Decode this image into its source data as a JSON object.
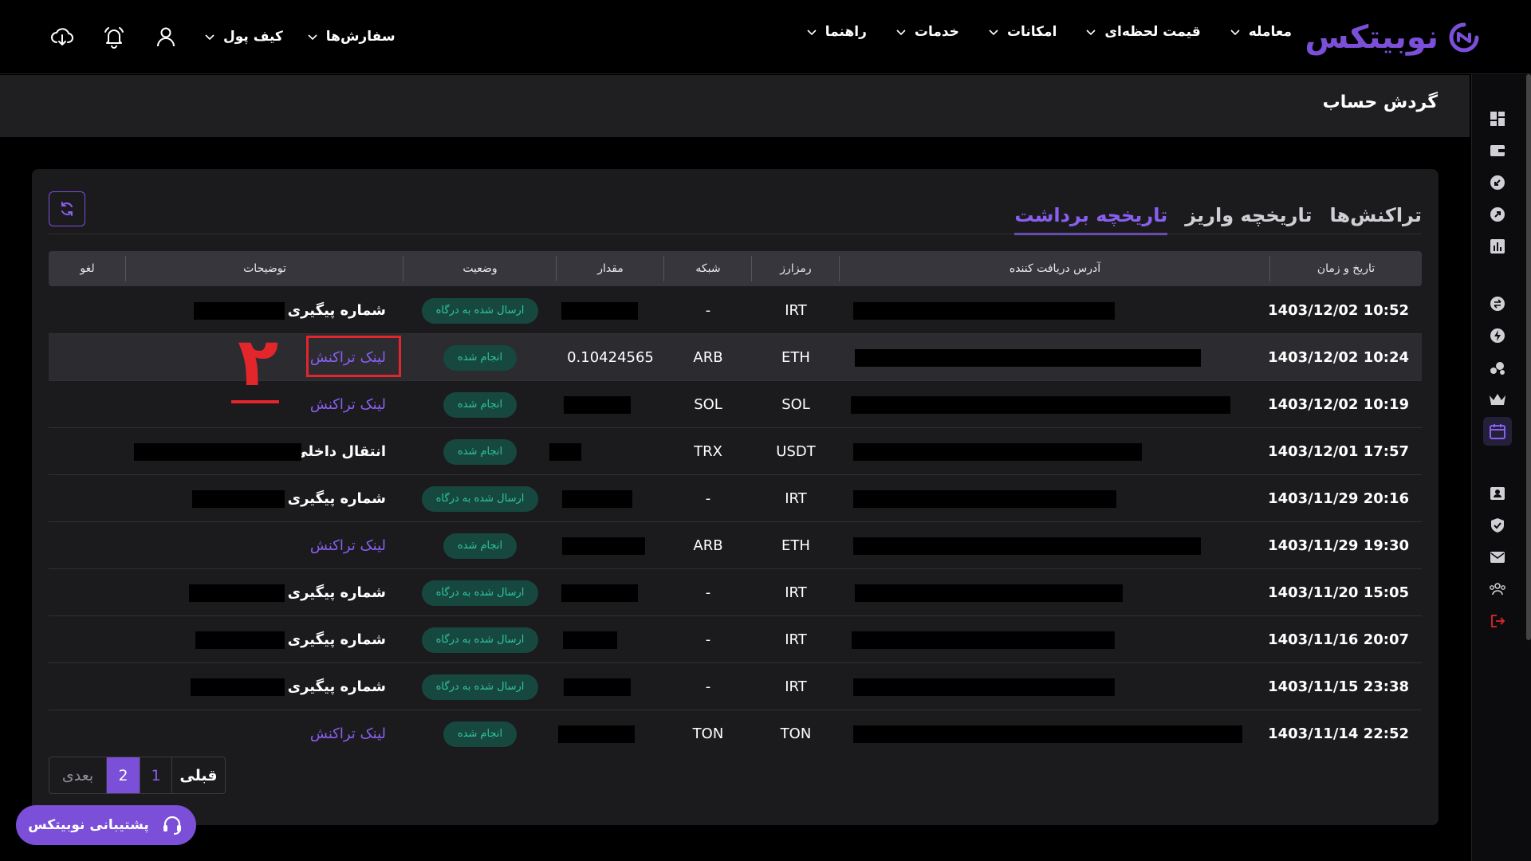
{
  "header": {
    "logo_text": "نوبیتکس",
    "nav": [
      "معامله",
      "قیمت لحظه‌ای",
      "امکانات",
      "خدمات",
      "راهنما"
    ],
    "user_nav": [
      "سفارش‌ها",
      "کیف پول"
    ]
  },
  "page": {
    "title": "گردش حساب"
  },
  "tabs": [
    "تراکنش‌ها",
    "تاریخچه واریز",
    "تاریخچه برداشت"
  ],
  "active_tab": "تاریخچه برداشت",
  "table": {
    "columns": [
      "تاریخ و زمان",
      "آدرس دریافت کننده",
      "رمزارز",
      "شبکه",
      "مقدار",
      "وضعیت",
      "توضیحات",
      "لغو"
    ],
    "rows": [
      {
        "date": "1403/12/02 10:52",
        "currency": "IRT",
        "network": "-",
        "amount": "",
        "status": "ارسال شده به درگاه",
        "desc": "شماره پیگیری"
      },
      {
        "date": "1403/12/02 10:24",
        "currency": "ETH",
        "network": "ARB",
        "amount": "0.10424565",
        "status": "انجام شده",
        "desc": "لینک تراکنش"
      },
      {
        "date": "1403/12/02 10:19",
        "currency": "SOL",
        "network": "SOL",
        "amount": "",
        "status": "انجام شده",
        "desc": "لینک تراکنش"
      },
      {
        "date": "1403/12/01 17:57",
        "currency": "USDT",
        "network": "TRX",
        "amount": "",
        "status": "انجام شده",
        "desc": "انتقال داخلی"
      },
      {
        "date": "1403/11/29 20:16",
        "currency": "IRT",
        "network": "-",
        "amount": "",
        "status": "ارسال شده به درگاه",
        "desc": "شماره پیگیری"
      },
      {
        "date": "1403/11/29 19:30",
        "currency": "ETH",
        "network": "ARB",
        "amount": "",
        "status": "انجام شده",
        "desc": "لینک تراکنش"
      },
      {
        "date": "1403/11/20 15:05",
        "currency": "IRT",
        "network": "-",
        "amount": "",
        "status": "ارسال شده به درگاه",
        "desc": "شماره پیگیری"
      },
      {
        "date": "1403/11/16 20:07",
        "currency": "IRT",
        "network": "-",
        "amount": "",
        "status": "ارسال شده به درگاه",
        "desc": "شماره پیگیری"
      },
      {
        "date": "1403/11/15 23:38",
        "currency": "IRT",
        "network": "-",
        "amount": "",
        "status": "ارسال شده به درگاه",
        "desc": "شماره پیگیری"
      },
      {
        "date": "1403/11/14 22:52",
        "currency": "TON",
        "network": "TON",
        "amount": "",
        "status": "انجام شده",
        "desc": "لینک تراکنش"
      }
    ]
  },
  "annotation": {
    "number": "۲"
  },
  "pagination": {
    "prev": "قبلی",
    "pages": [
      "1",
      "2"
    ],
    "current": "2",
    "next": "بعدی"
  },
  "support": {
    "label": "پشتیبانی نوبیتکس"
  },
  "colors": {
    "accent": "#7b4fd8",
    "status_bg": "#17483f",
    "status_text": "#2fc59a",
    "annotation": "#e3262b"
  }
}
